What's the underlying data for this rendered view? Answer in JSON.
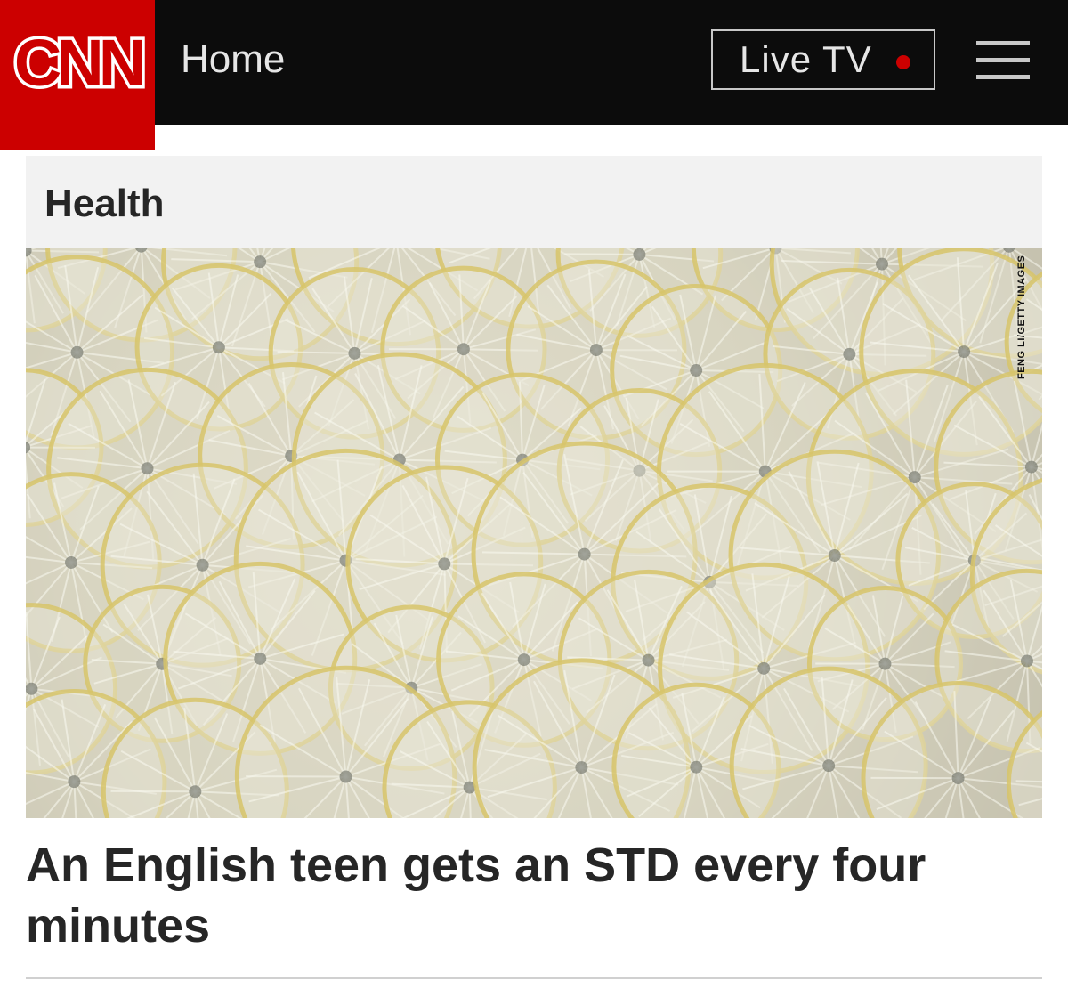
{
  "header": {
    "logo_text": "CNN",
    "nav_label": "Home",
    "live_tv_label": "Live TV",
    "menu_icon": "hamburger-menu-icon",
    "colors": {
      "brand_red": "#cc0000",
      "bar_black": "#0c0c0c"
    }
  },
  "section": {
    "label": "Health"
  },
  "hero": {
    "photo_credit": "FENG LI/GETTY IMAGES"
  },
  "article": {
    "headline": "An English teen gets an STD every four minutes"
  }
}
